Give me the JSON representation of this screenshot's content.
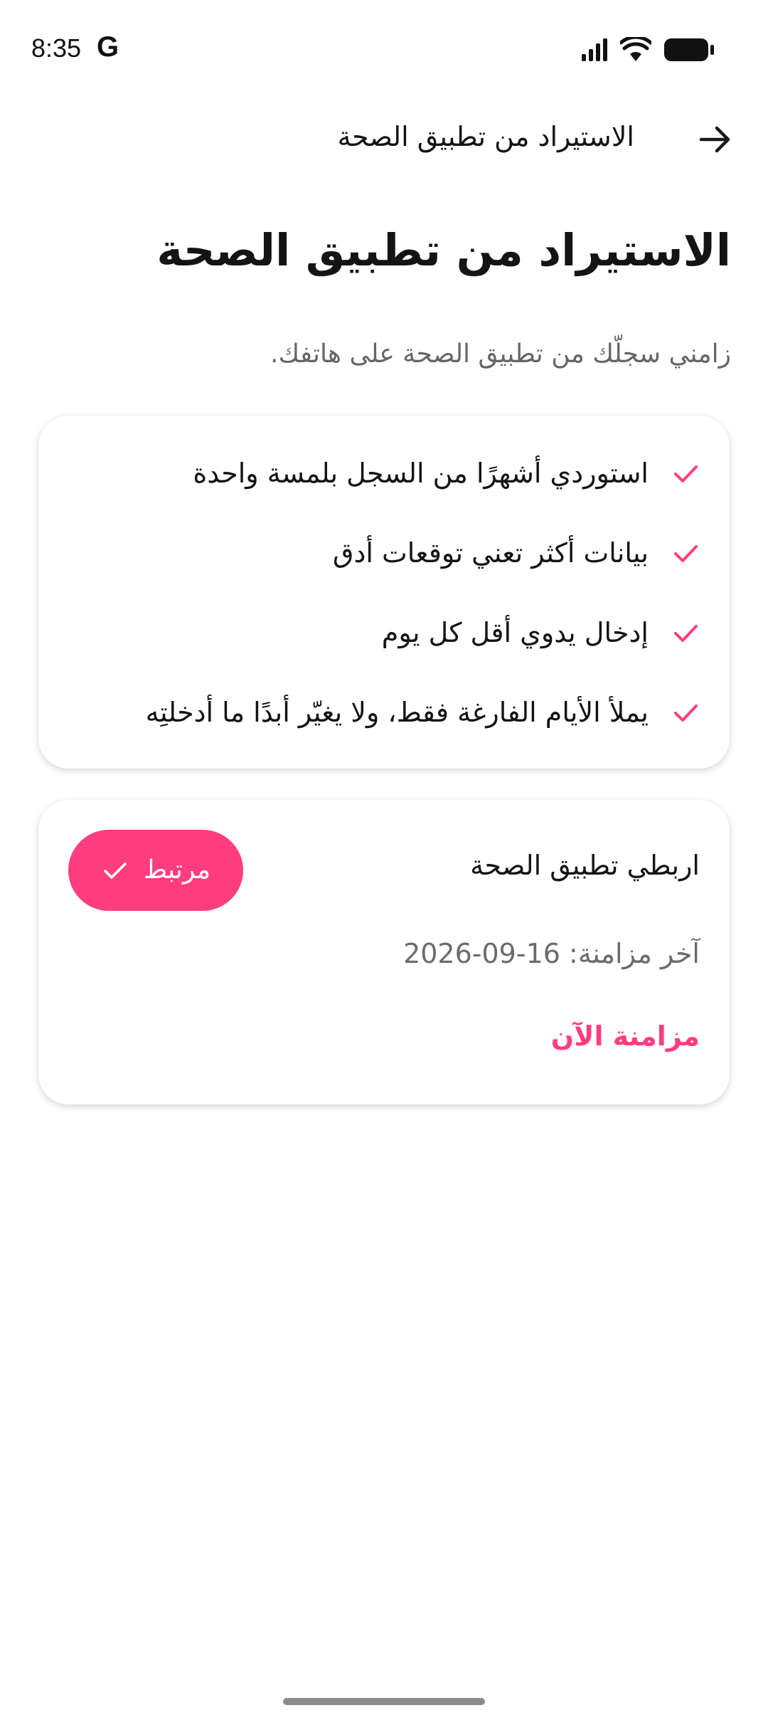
{
  "status_bar": {
    "time": "8:35",
    "google_glyph": "G"
  },
  "top_bar": {
    "title": "الاستيراد من تطبيق الصحة",
    "back_icon": "arrow-icon"
  },
  "header": {
    "title": "الاستيراد من تطبيق الصحة",
    "subtitle": "زامني سجلّك من تطبيق الصحة على هاتفك."
  },
  "benefits": {
    "items": [
      {
        "label": "استوردي أشهرًا من السجل بلمسة واحدة"
      },
      {
        "label": "بيانات أكثر تعني توقعات أدق"
      },
      {
        "label": "إدخال يدوي أقل كل يوم"
      },
      {
        "label": "يملأ الأيام الفارغة فقط، ولا يغيّر أبدًا ما أدخلتِه"
      }
    ]
  },
  "link_card": {
    "title": "اربطي تطبيق الصحة",
    "status_label": "مرتبط",
    "last_sync": "آخر مزامنة: 16-09-2026",
    "sync_now_label": "مزامنة الآن"
  },
  "colors": {
    "accent": "#ff3d7f",
    "text": "#141414",
    "muted": "#666666"
  }
}
